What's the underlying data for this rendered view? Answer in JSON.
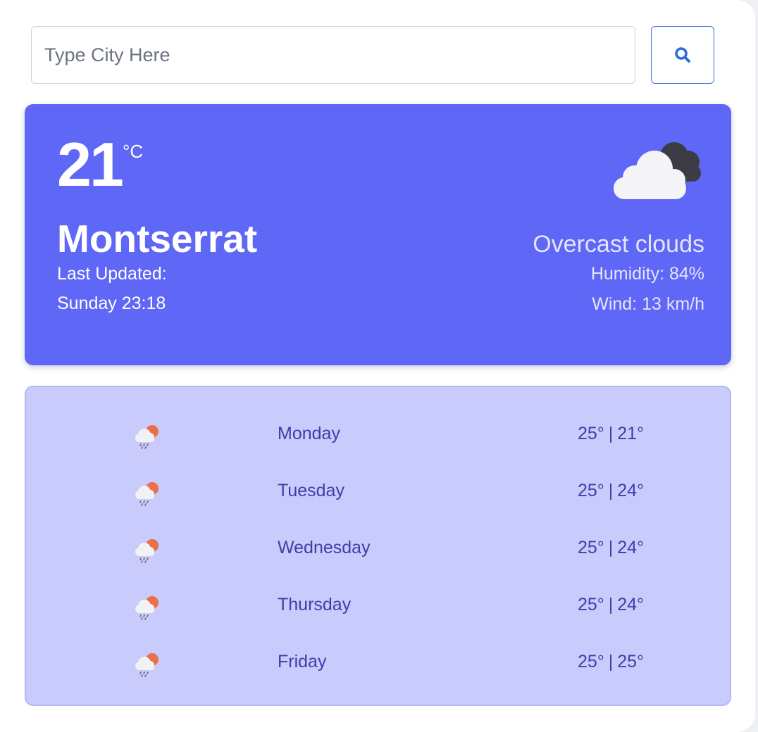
{
  "search": {
    "placeholder": "Type City Here",
    "value": "",
    "button_icon": "search-icon"
  },
  "current": {
    "temperature": "21",
    "unit": "°C",
    "city": "Montserrat",
    "updated_label": "Last Updated:",
    "updated_time": "Sunday 23:18",
    "condition": "Overcast clouds",
    "humidity": "Humidity: 84%",
    "wind": "Wind: 13 km/h",
    "icon": "overcast-clouds-icon"
  },
  "forecast": [
    {
      "day": "Monday",
      "high": "25°",
      "separator": "|",
      "low": "21°",
      "icon": "rain-sun-cloud-icon"
    },
    {
      "day": "Tuesday",
      "high": "25°",
      "separator": "|",
      "low": "24°",
      "icon": "rain-sun-cloud-icon"
    },
    {
      "day": "Wednesday",
      "high": "25°",
      "separator": "|",
      "low": "24°",
      "icon": "rain-sun-cloud-icon"
    },
    {
      "day": "Thursday",
      "high": "25°",
      "separator": "|",
      "low": "24°",
      "icon": "rain-sun-cloud-icon"
    },
    {
      "day": "Friday",
      "high": "25°",
      "separator": "|",
      "low": "25°",
      "icon": "rain-sun-cloud-icon"
    }
  ],
  "colors": {
    "current_card": "#5f67f6",
    "forecast_card": "#c8cbfb",
    "forecast_text": "#3c3fa8",
    "search_accent": "#3b6fd9"
  }
}
